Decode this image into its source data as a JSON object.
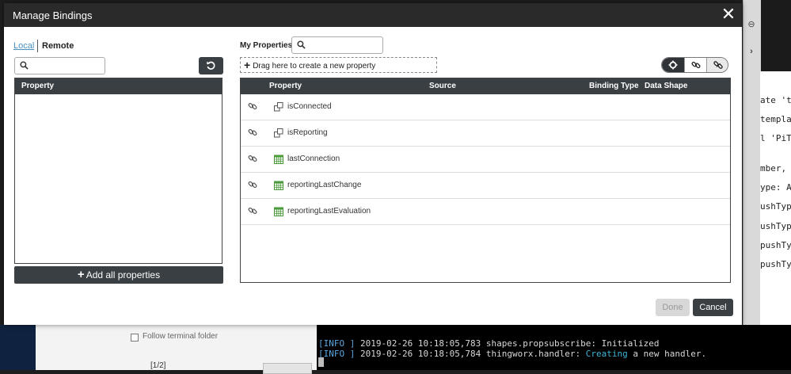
{
  "modal": {
    "title": "Manage Bindings",
    "close_label": "✕"
  },
  "left": {
    "tabs": {
      "local": "Local",
      "remote": "Remote"
    },
    "search_placeholder": "",
    "table_header": "Property",
    "add_all_label": "Add all properties",
    "add_all_plus": "+"
  },
  "right": {
    "label": "My Properties",
    "search_placeholder": "",
    "dropzone_plus": "+",
    "dropzone_label": "Drag here to create a new property",
    "headers": {
      "property": "Property",
      "source": "Source",
      "binding_type": "Binding Type",
      "data_shape": "Data Shape"
    },
    "rows": [
      {
        "name": "isConnected",
        "type_icon": "boolean-icon"
      },
      {
        "name": "isReporting",
        "type_icon": "boolean-icon"
      },
      {
        "name": "lastConnection",
        "type_icon": "datetime-icon"
      },
      {
        "name": "reportingLastChange",
        "type_icon": "datetime-icon"
      },
      {
        "name": "reportingLastEvaluation",
        "type_icon": "datetime-icon"
      }
    ],
    "view_toggle": [
      "all-icon",
      "bound-icon",
      "unbound-icon"
    ]
  },
  "footer": {
    "done": "Done",
    "cancel": "Cancel"
  },
  "background": {
    "code_lines": [
      "ate 't",
      "templa",
      "l 'PiTh",
      "mber,",
      "ype: A",
      "ushTyp",
      "ushTyp",
      "pushTy",
      "pushTy"
    ],
    "follow_label": "Follow terminal folder",
    "page_indicator": "[1/2]",
    "console": [
      {
        "tag": "[INFO ]",
        "text": " 2019-02-26 10:18:05,783 shapes.propsubscribe: Initialized",
        "hl": ""
      },
      {
        "tag": "[INFO ]",
        "text": " 2019-02-26 10:18:05,784 thingworx.handler: ",
        "hl": "Creating",
        "rest": " a new handler."
      }
    ]
  },
  "colors": {
    "header": "#2a2a2a",
    "dark_button": "#3a3f44",
    "link": "#4a90c2",
    "icon_green": "#4a9a3a"
  }
}
